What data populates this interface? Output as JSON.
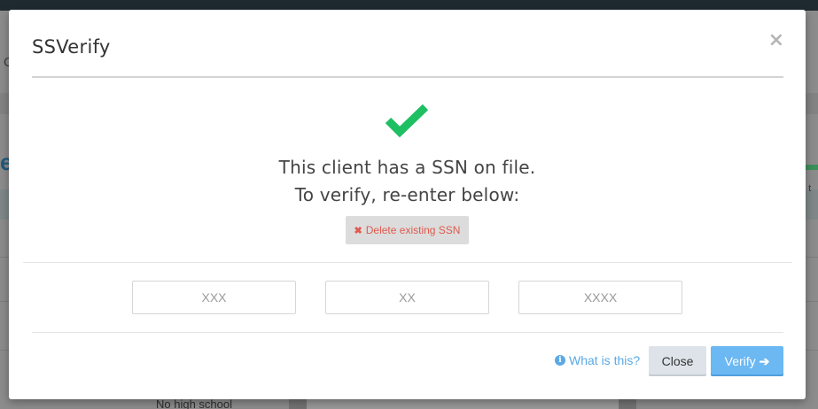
{
  "background": {
    "letter_c": "C",
    "letter_e": "e",
    "right_text": "n t",
    "bottom_text": "No high school"
  },
  "modal": {
    "title": "SSVerify",
    "close_glyph": "×",
    "icon": "checkmark-icon",
    "message_line1": "This client has a SSN on file.",
    "message_line2": "To verify, re-enter below:",
    "delete_button": {
      "icon": "times-icon",
      "icon_glyph": "✖",
      "label": "Delete existing SSN"
    },
    "ssn_fields": {
      "part1_placeholder": "XXX",
      "part2_placeholder": "XX",
      "part3_placeholder": "XXXX"
    },
    "footer": {
      "help_icon": "info-circle-icon",
      "help_icon_glyph": "i",
      "help_label": "What is this?",
      "close_label": "Close",
      "verify_label": "Verify",
      "verify_icon": "arrow-right-icon",
      "verify_icon_glyph": "➔"
    }
  },
  "colors": {
    "check_green": "#1fbf63",
    "delete_red": "#e05a4e",
    "link_blue": "#5aa9e6",
    "verify_blue": "#6bb8f3"
  }
}
